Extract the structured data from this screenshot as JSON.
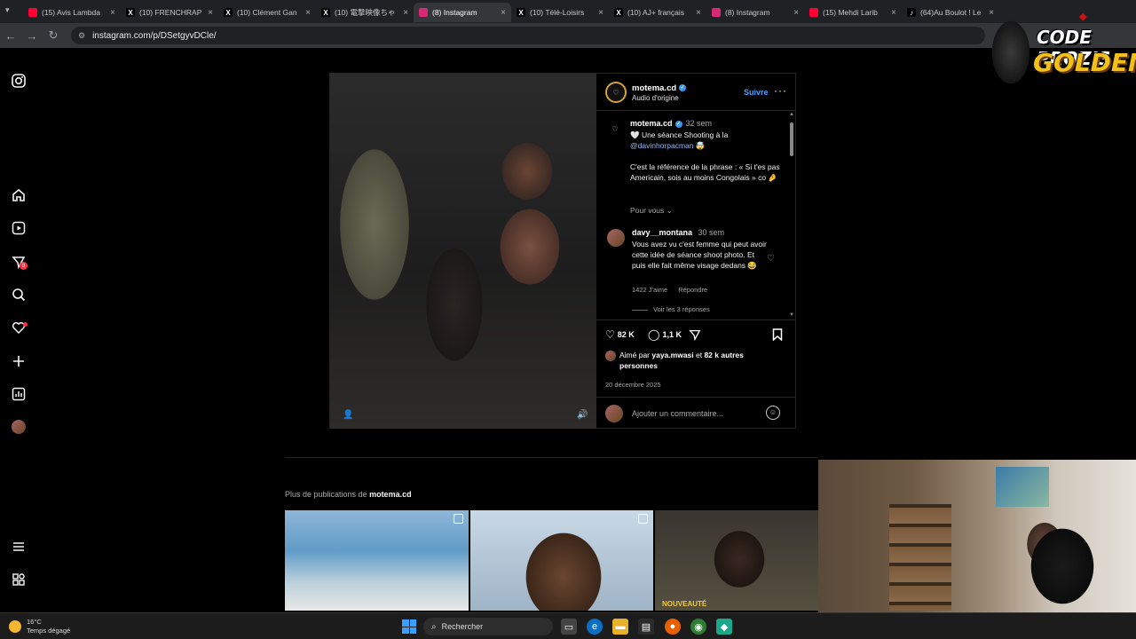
{
  "browser": {
    "tabs": [
      {
        "label": "(15) Avis Lambda",
        "icon": "youtube-icon",
        "color": "#ff0033"
      },
      {
        "label": "(10) FRENCHRAP",
        "icon": "x-icon",
        "color": "#000000"
      },
      {
        "label": "(10) Clément Gan",
        "icon": "x-icon",
        "color": "#000000"
      },
      {
        "label": "(10) 電撃映像ちゃ",
        "icon": "x-icon",
        "color": "#000000"
      },
      {
        "label": "(8) Instagram",
        "icon": "instagram-icon",
        "color": "#d62976",
        "active": true
      },
      {
        "label": "(10) Télé-Loisirs",
        "icon": "x-icon",
        "color": "#000000"
      },
      {
        "label": "(10) AJ+ français",
        "icon": "x-icon",
        "color": "#000000"
      },
      {
        "label": "(8) Instagram",
        "icon": "instagram-icon",
        "color": "#d62976"
      },
      {
        "label": "(15) Mehdi Larib",
        "icon": "youtube-icon",
        "color": "#ff0033"
      },
      {
        "label": "(64)Au Boulot ! Le",
        "icon": "tiktok-icon",
        "color": "#000000"
      }
    ],
    "url": "instagram.com/p/DSetgyvDCle/"
  },
  "post": {
    "username": "motema.cd",
    "audio": "Audio d'origine",
    "follow_label": "Suivre",
    "caption_time": "32 sem",
    "caption_line1": "🤍 Une séance Shooting à la",
    "caption_mention": "@davinhorpacman",
    "caption_emoji1": " 🤯",
    "caption_line2": "C'est la référence de la phrase : « Si t'es pas Americain, sois au moins Congolais » co 🤌",
    "translation_label": "Pour vous",
    "comment": {
      "user": "davy__montana",
      "time": "30 sem",
      "text": "Vous avez vu c'est femme qui peut avoir cette idée de séance shoot photo. Et puis elle fait même visage dedans 😂",
      "likes": "1422 J'aime",
      "reply_label": "Répondre",
      "view_replies": "Voir les 3 réponses"
    },
    "likes": "82 K",
    "comments_count": "1,1 K",
    "liked_by_prefix": "Aimé par ",
    "liked_by_user": "yaya.mwasi",
    "liked_by_suffix": " et ",
    "liked_by_others": "82 k autres personnes",
    "date": "20 décembre 2025",
    "add_comment_placeholder": "Ajouter un commentaire..."
  },
  "more_posts": {
    "prefix": "Plus de publications de ",
    "user": "motema.cd",
    "thumb3_caption": "NOUVEAUTÉ"
  },
  "overlay": {
    "line1": "CODE PROZIS",
    "line2": "GOLDENG"
  },
  "taskbar": {
    "temperature": "16°C",
    "weather": "Temps dégagé",
    "search_label": "Rechercher"
  }
}
